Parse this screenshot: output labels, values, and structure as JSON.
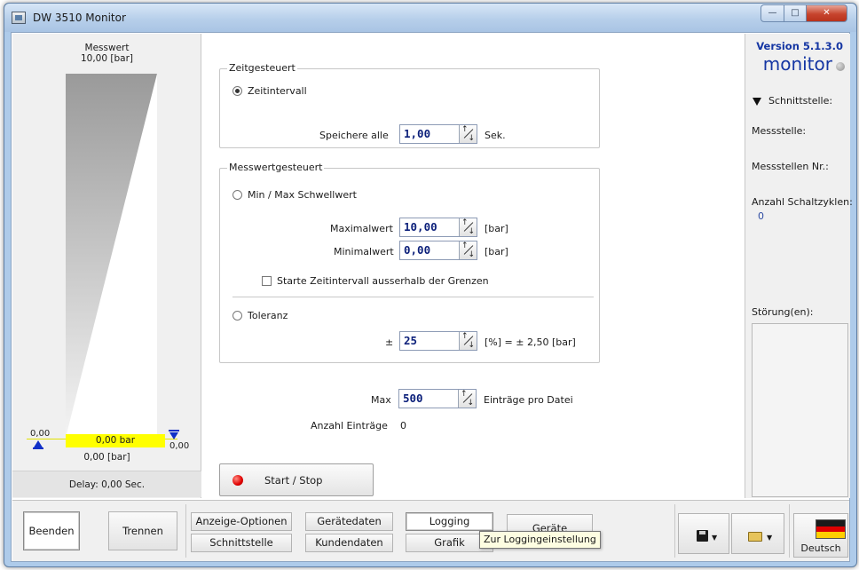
{
  "window": {
    "title": "DW 3510 Monitor"
  },
  "gauge": {
    "title": "Messwert",
    "max_label": "10,00 [bar]",
    "left_min": "0,00",
    "right_min": "0,00",
    "current_value": "0,00 bar",
    "current_unit": "0,00 [bar]",
    "delay": "Delay: 0,00 Sec.",
    "fill_fraction": 0.0
  },
  "zeit": {
    "title": "Zeitgesteuert",
    "radio_label": "Zeitintervall",
    "save_label": "Speichere alle",
    "save_value": "1,00",
    "save_unit": "Sek."
  },
  "mess": {
    "title": "Messwertgesteuert",
    "minmax_label": "Min / Max Schwellwert",
    "max_label": "Maximalwert",
    "max_value": "10,00",
    "max_unit": "[bar]",
    "min_label": "Minimalwert",
    "min_value": "0,00",
    "min_unit": "[bar]",
    "checkbox_label": "Starte Zeitintervall ausserhalb der Grenzen",
    "tol_label": "Toleranz",
    "tol_prefix": "±",
    "tol_value": "25",
    "tol_suffix": "[%] = ± 2,50 [bar]"
  },
  "entries": {
    "max_label": "Max",
    "max_value": "500",
    "max_suffix": "Einträge pro Datei",
    "count_label": "Anzahl Einträge",
    "count_value": "0"
  },
  "start_button": "Start / Stop",
  "right": {
    "version": "Version 5.1.3.0",
    "brand": "monitor",
    "interface_label": "Schnittstelle:",
    "messstelle": "Messstelle:",
    "messstellen_nr": "Messstellen Nr.:",
    "schaltzyklen": "Anzahl Schaltzyklen:",
    "schaltzyklen_value": "0",
    "stoerungen": "Störung(en):"
  },
  "toolbar": {
    "beenden": "Beenden",
    "trennen": "Trennen",
    "anzeige_optionen": "Anzeige-Optionen",
    "schnittstelle": "Schnittstelle",
    "geraetedaten": "Gerätedaten",
    "kundendaten": "Kundendaten",
    "logging": "Logging",
    "grafik": "Grafik",
    "geraete": "Geräte",
    "tooltip": "Zur Loggingeinstellung",
    "language": "Deutsch"
  },
  "icons": {
    "save": "save-icon",
    "open": "folder-open-icon",
    "flag": "german-flag-icon"
  }
}
